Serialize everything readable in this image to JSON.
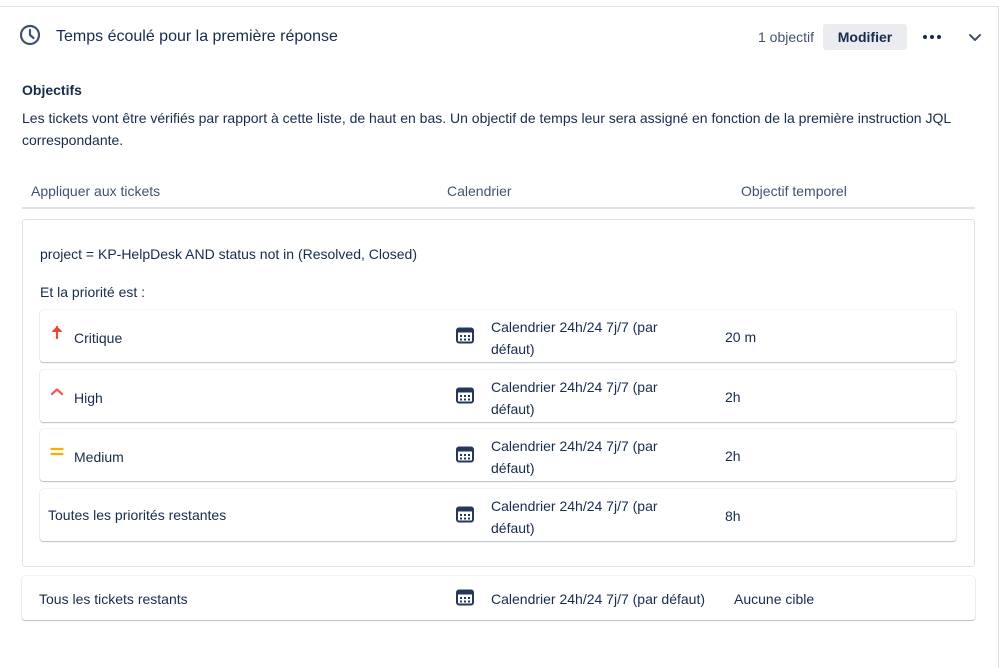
{
  "header": {
    "title": "Temps écoulé pour la première réponse",
    "goal_count": "1 objectif",
    "modify_label": "Modifier"
  },
  "goals": {
    "section_title": "Objectifs",
    "description": "Les tickets vont être vérifiés par rapport à cette liste, de haut en bas. Un objectif de temps leur sera assigné en fonction de la première instruction JQL correspondante."
  },
  "columns": {
    "apply": "Appliquer aux tickets",
    "calendar": "Calendrier",
    "target": "Objectif temporel"
  },
  "group": {
    "jql": "project = KP-HelpDesk AND status not in (Resolved, Closed)",
    "priority_label": "Et la priorité est :",
    "rows": [
      {
        "priority": "Critique",
        "calendar": "Calendrier 24h/24 7j/7 (par défaut)",
        "target": "20 m",
        "icon": "arrow-up-icon",
        "color": "#e5493a"
      },
      {
        "priority": "High",
        "calendar": "Calendrier 24h/24 7j/7 (par défaut)",
        "target": "2h",
        "icon": "chevron-up-icon",
        "color": "#f15b50"
      },
      {
        "priority": "Medium",
        "calendar": "Calendrier 24h/24 7j/7 (par défaut)",
        "target": "2h",
        "icon": "equals-icon",
        "color": "#ffab00"
      },
      {
        "priority": "Toutes les priorités restantes",
        "calendar": "Calendrier 24h/24 7j/7 (par défaut)",
        "target": "8h"
      }
    ]
  },
  "remaining": {
    "label": "Tous les tickets restants",
    "calendar": "Calendrier 24h/24 7j/7 (par défaut)",
    "target": "Aucune cible"
  }
}
